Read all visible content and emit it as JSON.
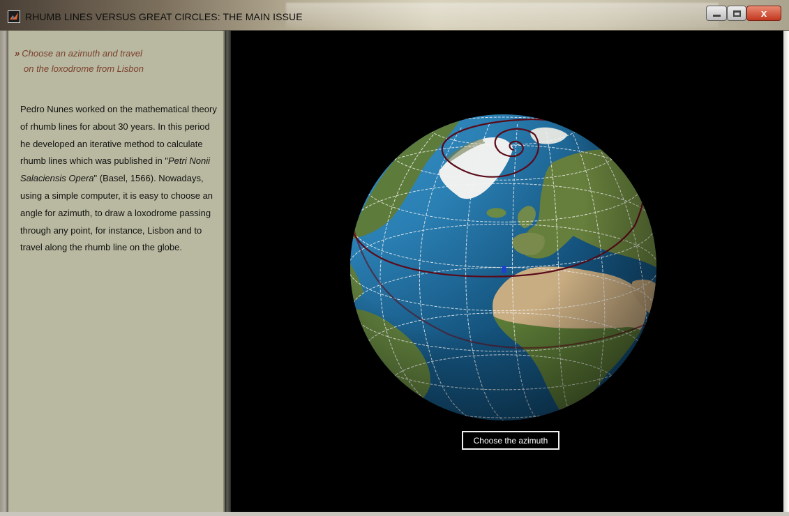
{
  "window": {
    "title": "RHUMB LINES VERSUS GREAT CIRCLES: THE MAIN ISSUE",
    "icons": {
      "app": "matlab-icon",
      "minimize": "minimize-icon",
      "maximize": "maximize-icon",
      "close": "close-icon"
    },
    "close_glyph": "x"
  },
  "panel": {
    "bullet": "»",
    "heading_line1": "Choose an azimuth and travel",
    "heading_line2": "on the loxodrome from Lisbon",
    "body_before_title": "Pedro Nunes worked on the mathematical theory of rhumb lines for about 30 years. In this period he developed an iterative method to calculate rhumb lines which was published in \"",
    "book_title_1": "Petri Nonii Salaciensis",
    "book_title_2": "Opera",
    "body_after_title": "\" (Basel, 1566). Nowadays, using a simple computer, it is easy to choose an angle for azimuth, to draw a loxodrome passing through any point, for instance, Lisbon and to travel along the rhumb line on the globe."
  },
  "main": {
    "button_label": "Choose the azimuth"
  },
  "colors": {
    "panel_bg": "#b9b9a1",
    "heading": "#7a3e2c",
    "ocean": "#2f86b8",
    "land": "#667f3c",
    "desert": "#c9ad82",
    "ice": "#f4f4f4",
    "rhumb_line": "#5a0a18",
    "lisbon_marker": "#1f3fd0"
  }
}
